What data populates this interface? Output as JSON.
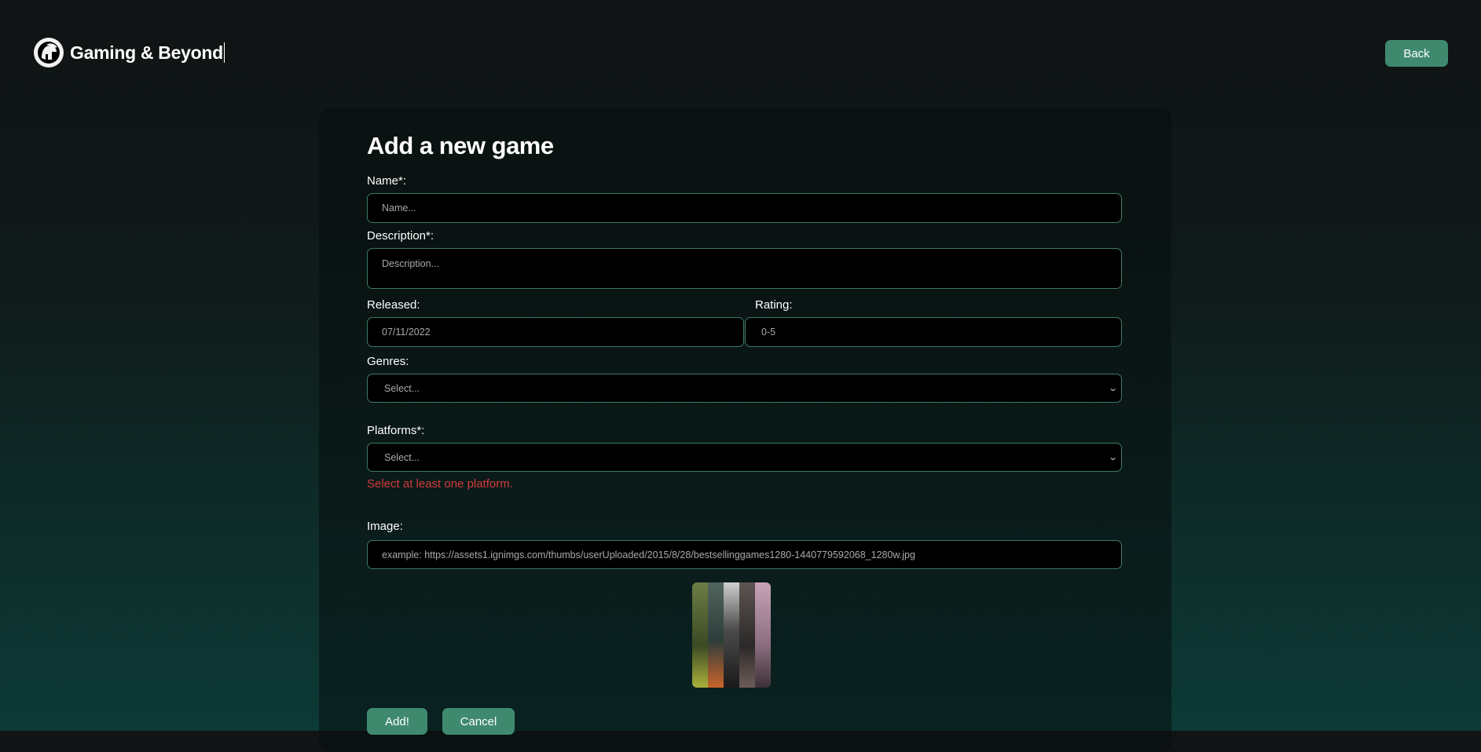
{
  "header": {
    "title": "Gaming & Beyond",
    "logo_icon": "spartan-helmet-icon",
    "back_label": "Back"
  },
  "form": {
    "title": "Add a new game",
    "name": {
      "label": "Name*:",
      "placeholder": "Name..."
    },
    "description": {
      "label": "Description*:",
      "placeholder": "Description..."
    },
    "released": {
      "label": "Released:",
      "value": "07/11/2022"
    },
    "rating": {
      "label": "Rating:",
      "placeholder": "0-5"
    },
    "genres": {
      "label": "Genres:",
      "selected": "Select..."
    },
    "platforms": {
      "label": "Platforms*:",
      "selected": "Select...",
      "error": "Select at least one platform."
    },
    "image": {
      "label": "Image:",
      "placeholder": "example: https://assets1.ignimgs.com/thumbs/userUploaded/2015/8/28/bestsellinggames1280-1440779592068_1280w.jpg"
    },
    "add_label": "Add!",
    "cancel_label": "Cancel"
  },
  "colors": {
    "accent": "#3f8a6f",
    "error": "#d23b3b",
    "field_border": "#3d7a66"
  }
}
